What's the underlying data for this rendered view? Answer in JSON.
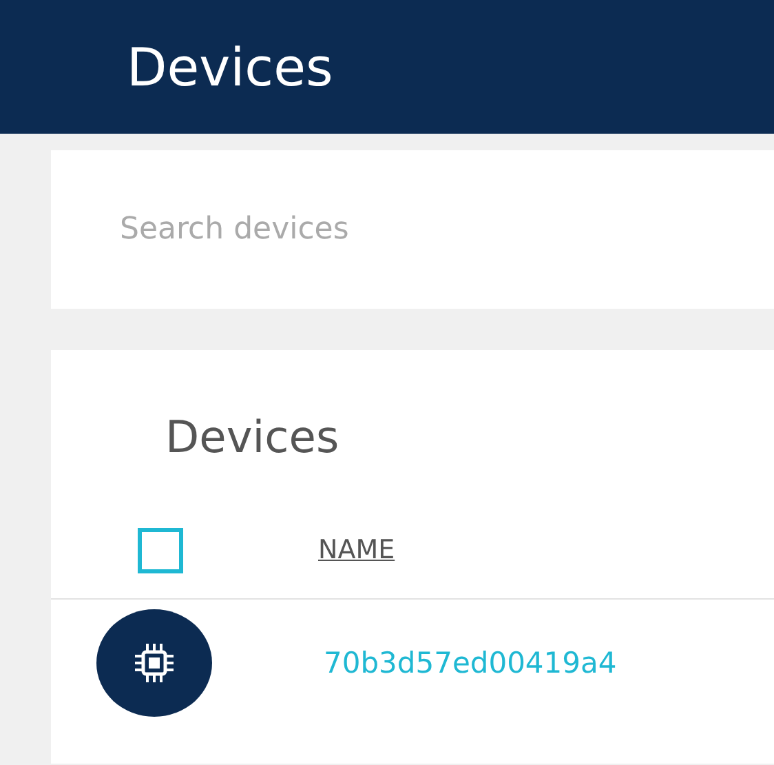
{
  "header": {
    "title": "Devices"
  },
  "search": {
    "placeholder": "Search devices"
  },
  "card": {
    "title": "Devices",
    "select_all": {
      "checked": false
    },
    "columns": [
      "NAME"
    ],
    "rows": [
      {
        "name": "70b3d57ed00419a4"
      }
    ]
  }
}
